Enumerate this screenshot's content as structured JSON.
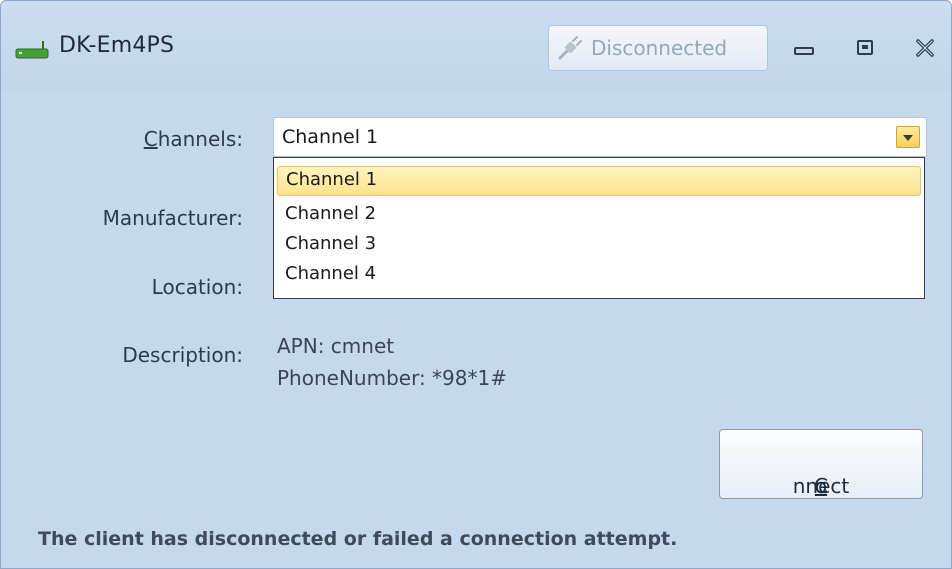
{
  "window": {
    "title": "DK-Em4PS",
    "status_button": "Disconnected",
    "icons": {
      "app": "modem-icon",
      "status": "plug-icon",
      "minimize": "minimize-icon",
      "maximize": "maximize-icon",
      "close": "close-icon"
    }
  },
  "form": {
    "channels_label": "Channels:",
    "manufacturer_label": "Manufacturer:",
    "location_label": "Location:",
    "description_label": "Description:",
    "channels_value": "Channel  1",
    "channels_options": [
      "Channel  1",
      "Channel  2",
      "Channel  3",
      "Channel  4"
    ],
    "selected_option_index": 0,
    "description_lines": [
      "APN: cmnet",
      "PhoneNumber: *98*1#"
    ]
  },
  "actions": {
    "connect_pre": "C",
    "connect_hotkey": "o",
    "connect_post": "nnect"
  },
  "status_bar": {
    "message": "The client has disconnected or failed a connection attempt."
  },
  "colors": {
    "window_bg": "#c5d8ee",
    "highlight": "#fde38a",
    "combo_button": "#f8cf52"
  }
}
